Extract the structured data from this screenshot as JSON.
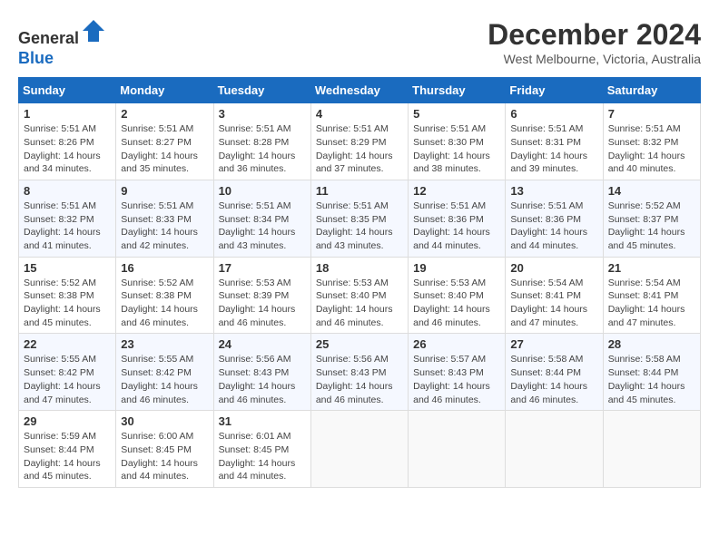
{
  "header": {
    "logo_line1": "General",
    "logo_line2": "Blue",
    "month_year": "December 2024",
    "location": "West Melbourne, Victoria, Australia"
  },
  "days_of_week": [
    "Sunday",
    "Monday",
    "Tuesday",
    "Wednesday",
    "Thursday",
    "Friday",
    "Saturday"
  ],
  "weeks": [
    [
      {
        "day": "1",
        "sunrise": "5:51 AM",
        "sunset": "8:26 PM",
        "daylight": "14 hours and 34 minutes."
      },
      {
        "day": "2",
        "sunrise": "5:51 AM",
        "sunset": "8:27 PM",
        "daylight": "14 hours and 35 minutes."
      },
      {
        "day": "3",
        "sunrise": "5:51 AM",
        "sunset": "8:28 PM",
        "daylight": "14 hours and 36 minutes."
      },
      {
        "day": "4",
        "sunrise": "5:51 AM",
        "sunset": "8:29 PM",
        "daylight": "14 hours and 37 minutes."
      },
      {
        "day": "5",
        "sunrise": "5:51 AM",
        "sunset": "8:30 PM",
        "daylight": "14 hours and 38 minutes."
      },
      {
        "day": "6",
        "sunrise": "5:51 AM",
        "sunset": "8:31 PM",
        "daylight": "14 hours and 39 minutes."
      },
      {
        "day": "7",
        "sunrise": "5:51 AM",
        "sunset": "8:32 PM",
        "daylight": "14 hours and 40 minutes."
      }
    ],
    [
      {
        "day": "8",
        "sunrise": "5:51 AM",
        "sunset": "8:32 PM",
        "daylight": "14 hours and 41 minutes."
      },
      {
        "day": "9",
        "sunrise": "5:51 AM",
        "sunset": "8:33 PM",
        "daylight": "14 hours and 42 minutes."
      },
      {
        "day": "10",
        "sunrise": "5:51 AM",
        "sunset": "8:34 PM",
        "daylight": "14 hours and 43 minutes."
      },
      {
        "day": "11",
        "sunrise": "5:51 AM",
        "sunset": "8:35 PM",
        "daylight": "14 hours and 43 minutes."
      },
      {
        "day": "12",
        "sunrise": "5:51 AM",
        "sunset": "8:36 PM",
        "daylight": "14 hours and 44 minutes."
      },
      {
        "day": "13",
        "sunrise": "5:51 AM",
        "sunset": "8:36 PM",
        "daylight": "14 hours and 44 minutes."
      },
      {
        "day": "14",
        "sunrise": "5:52 AM",
        "sunset": "8:37 PM",
        "daylight": "14 hours and 45 minutes."
      }
    ],
    [
      {
        "day": "15",
        "sunrise": "5:52 AM",
        "sunset": "8:38 PM",
        "daylight": "14 hours and 45 minutes."
      },
      {
        "day": "16",
        "sunrise": "5:52 AM",
        "sunset": "8:38 PM",
        "daylight": "14 hours and 46 minutes."
      },
      {
        "day": "17",
        "sunrise": "5:53 AM",
        "sunset": "8:39 PM",
        "daylight": "14 hours and 46 minutes."
      },
      {
        "day": "18",
        "sunrise": "5:53 AM",
        "sunset": "8:40 PM",
        "daylight": "14 hours and 46 minutes."
      },
      {
        "day": "19",
        "sunrise": "5:53 AM",
        "sunset": "8:40 PM",
        "daylight": "14 hours and 46 minutes."
      },
      {
        "day": "20",
        "sunrise": "5:54 AM",
        "sunset": "8:41 PM",
        "daylight": "14 hours and 47 minutes."
      },
      {
        "day": "21",
        "sunrise": "5:54 AM",
        "sunset": "8:41 PM",
        "daylight": "14 hours and 47 minutes."
      }
    ],
    [
      {
        "day": "22",
        "sunrise": "5:55 AM",
        "sunset": "8:42 PM",
        "daylight": "14 hours and 47 minutes."
      },
      {
        "day": "23",
        "sunrise": "5:55 AM",
        "sunset": "8:42 PM",
        "daylight": "14 hours and 46 minutes."
      },
      {
        "day": "24",
        "sunrise": "5:56 AM",
        "sunset": "8:43 PM",
        "daylight": "14 hours and 46 minutes."
      },
      {
        "day": "25",
        "sunrise": "5:56 AM",
        "sunset": "8:43 PM",
        "daylight": "14 hours and 46 minutes."
      },
      {
        "day": "26",
        "sunrise": "5:57 AM",
        "sunset": "8:43 PM",
        "daylight": "14 hours and 46 minutes."
      },
      {
        "day": "27",
        "sunrise": "5:58 AM",
        "sunset": "8:44 PM",
        "daylight": "14 hours and 46 minutes."
      },
      {
        "day": "28",
        "sunrise": "5:58 AM",
        "sunset": "8:44 PM",
        "daylight": "14 hours and 45 minutes."
      }
    ],
    [
      {
        "day": "29",
        "sunrise": "5:59 AM",
        "sunset": "8:44 PM",
        "daylight": "14 hours and 45 minutes."
      },
      {
        "day": "30",
        "sunrise": "6:00 AM",
        "sunset": "8:45 PM",
        "daylight": "14 hours and 44 minutes."
      },
      {
        "day": "31",
        "sunrise": "6:01 AM",
        "sunset": "8:45 PM",
        "daylight": "14 hours and 44 minutes."
      },
      null,
      null,
      null,
      null
    ]
  ],
  "labels": {
    "sunrise": "Sunrise:",
    "sunset": "Sunset:",
    "daylight": "Daylight:"
  }
}
